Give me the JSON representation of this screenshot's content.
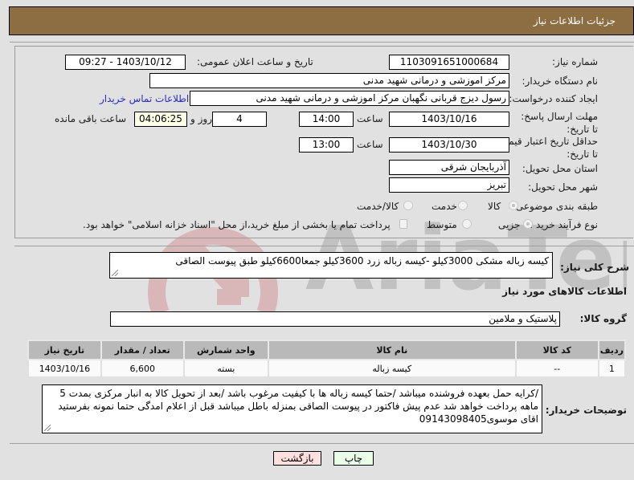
{
  "header": {
    "title": "جزئیات اطلاعات نیاز"
  },
  "form": {
    "need_number": {
      "label": "شماره نیاز:",
      "value": "1103091651000684"
    },
    "announce_datetime": {
      "label": "تاریخ و ساعت اعلان عمومی:",
      "value": "1403/10/12 - 09:27"
    },
    "buyer_org": {
      "label": "نام دستگاه خریدار:",
      "value": "مرکز اموزشی و درمانی شهید مدنی"
    },
    "requester": {
      "label": "ایجاد کننده درخواست:",
      "value": "رسول دیزج قربانی نگهبان مرکز اموزشی و درمانی شهید مدنی"
    },
    "buyer_contact_link": "اطلاعات تماس خریدار",
    "reply_deadline": {
      "label": "مهلت ارسال پاسخ: تا تاریخ:",
      "date": "1403/10/16",
      "time_label": "ساعت",
      "time": "14:00",
      "days": "4",
      "days_label": "روز و",
      "remaining": "04:06:25",
      "remaining_label": "ساعت باقی مانده"
    },
    "price_validity": {
      "label": "حداقل تاریخ اعتبار قیمت: تا تاریخ:",
      "date": "1403/10/30",
      "time_label": "ساعت",
      "time": "13:00"
    },
    "province": {
      "label": "استان محل تحویل:",
      "value": "آذربایجان شرقی"
    },
    "city": {
      "label": "شهر محل تحویل:",
      "value": "تبریز"
    },
    "category": {
      "label": "طبقه بندی موضوعی:",
      "options": [
        "کالا",
        "خدمت",
        "کالا/خدمت"
      ],
      "selected": "کالا"
    },
    "process_type": {
      "label": "نوع فرآیند خرید :",
      "options": [
        "جزیی",
        "متوسط"
      ],
      "selected": "جزیی",
      "checkbox_label": "پرداخت تمام یا بخشی از مبلغ خرید،از محل \"اسناد خزانه اسلامی\" خواهد بود."
    }
  },
  "description": {
    "label": "شرح کلی نیاز:",
    "value": "کیسه زباله مشکی 3000کیلو -کیسه زباله زرد 3600کیلو جمعا6600کیلو طبق پیوست الصاقی"
  },
  "goods_section_title": "اطلاعات کالاهای مورد نیاز",
  "goods_group": {
    "label": "گروه کالا:",
    "value": "پلاستیک و ملامین"
  },
  "table": {
    "headers": [
      "ردیف",
      "کد کالا",
      "نام کالا",
      "واحد شمارش",
      "تعداد / مقدار",
      "تاریخ نیاز"
    ],
    "rows": [
      [
        "1",
        "--",
        "کیسه زباله",
        "بسته",
        "6,600",
        "1403/10/16"
      ]
    ]
  },
  "buyer_notes": {
    "label": "توضیحات خریدار:",
    "value": "/کرایه حمل بعهده فروشنده میباشد /حتما کیسه زباله ها با کیفیت مرغوب باشد /بعد از تحویل کالا به انبار مرکزی بمدت 5 ماهه پرداخت خواهد شد عدم پیش فاکتور در پیوست الصاقی بمنزله باطل میباشد قبل از اعلام امدگی حتما نمونه بفرستید اقای موسوی09143098405"
  },
  "buttons": {
    "print": "چاپ",
    "back": "بازگشت"
  },
  "colors": {
    "header_bg": "#8d6d42",
    "print_bg": "#eaffea",
    "back_bg": "#ffe0e0",
    "link": "#2a2ac8"
  }
}
